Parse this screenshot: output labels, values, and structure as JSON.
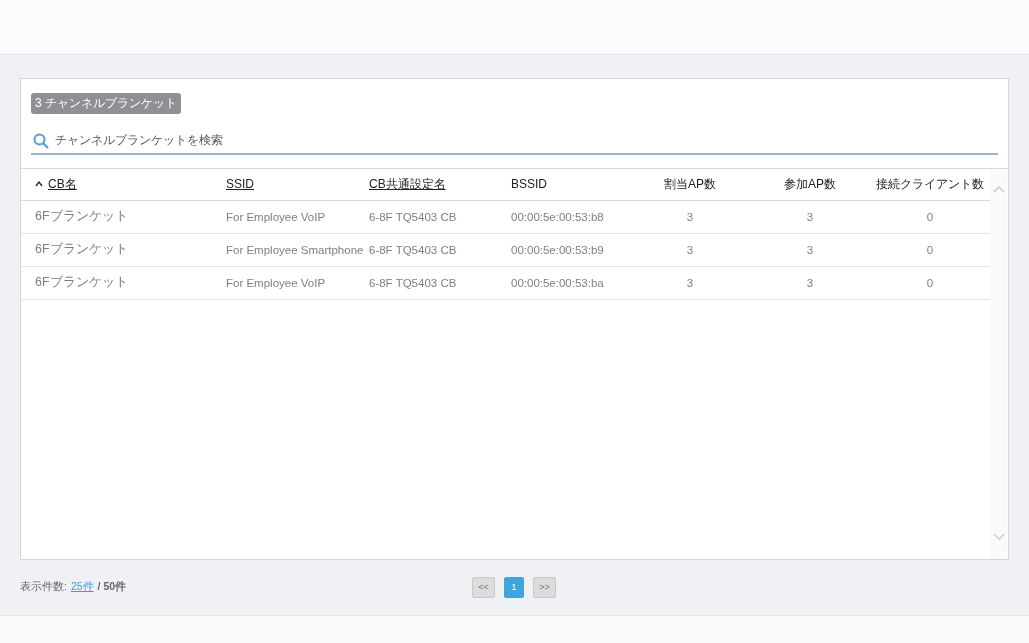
{
  "badge": "3 チャンネルブランケット",
  "search": {
    "placeholder": "チャンネルブランケットを検索"
  },
  "table": {
    "columns": [
      {
        "label": "CB名",
        "kind": "text",
        "sortable": true,
        "sorted": true
      },
      {
        "label": "SSID",
        "kind": "text",
        "sortable": true,
        "sorted": false
      },
      {
        "label": "CB共通設定名",
        "kind": "text",
        "sortable": true,
        "sorted": false
      },
      {
        "label": "BSSID",
        "kind": "text",
        "sortable": false,
        "sorted": false
      },
      {
        "label": "割当AP数",
        "kind": "number",
        "sortable": false,
        "sorted": false
      },
      {
        "label": "参加AP数",
        "kind": "number",
        "sortable": false,
        "sorted": false
      },
      {
        "label": "接続クライアント数",
        "kind": "number",
        "sortable": false,
        "sorted": false
      }
    ],
    "rows": [
      [
        "6Fブランケット",
        "For Employee VoIP",
        "6-8F TQ5403 CB",
        "00:00:5e:00:53:b8",
        "3",
        "3",
        "0"
      ],
      [
        "6Fブランケット",
        "For Employee Smartphone",
        "6-8F TQ5403 CB",
        "00:00:5e:00:53:b9",
        "3",
        "3",
        "0"
      ],
      [
        "6Fブランケット",
        "For Employee VoIP",
        "6-8F TQ5403 CB",
        "00:00:5e:00:53:ba",
        "3",
        "3",
        "0"
      ]
    ]
  },
  "footer": {
    "label": "表示件数:",
    "page_size": "25件",
    "total": "/ 50件"
  },
  "pagination": {
    "prev": "<<",
    "pages": [
      {
        "label": "1",
        "selected": true
      }
    ],
    "next": ">>"
  }
}
